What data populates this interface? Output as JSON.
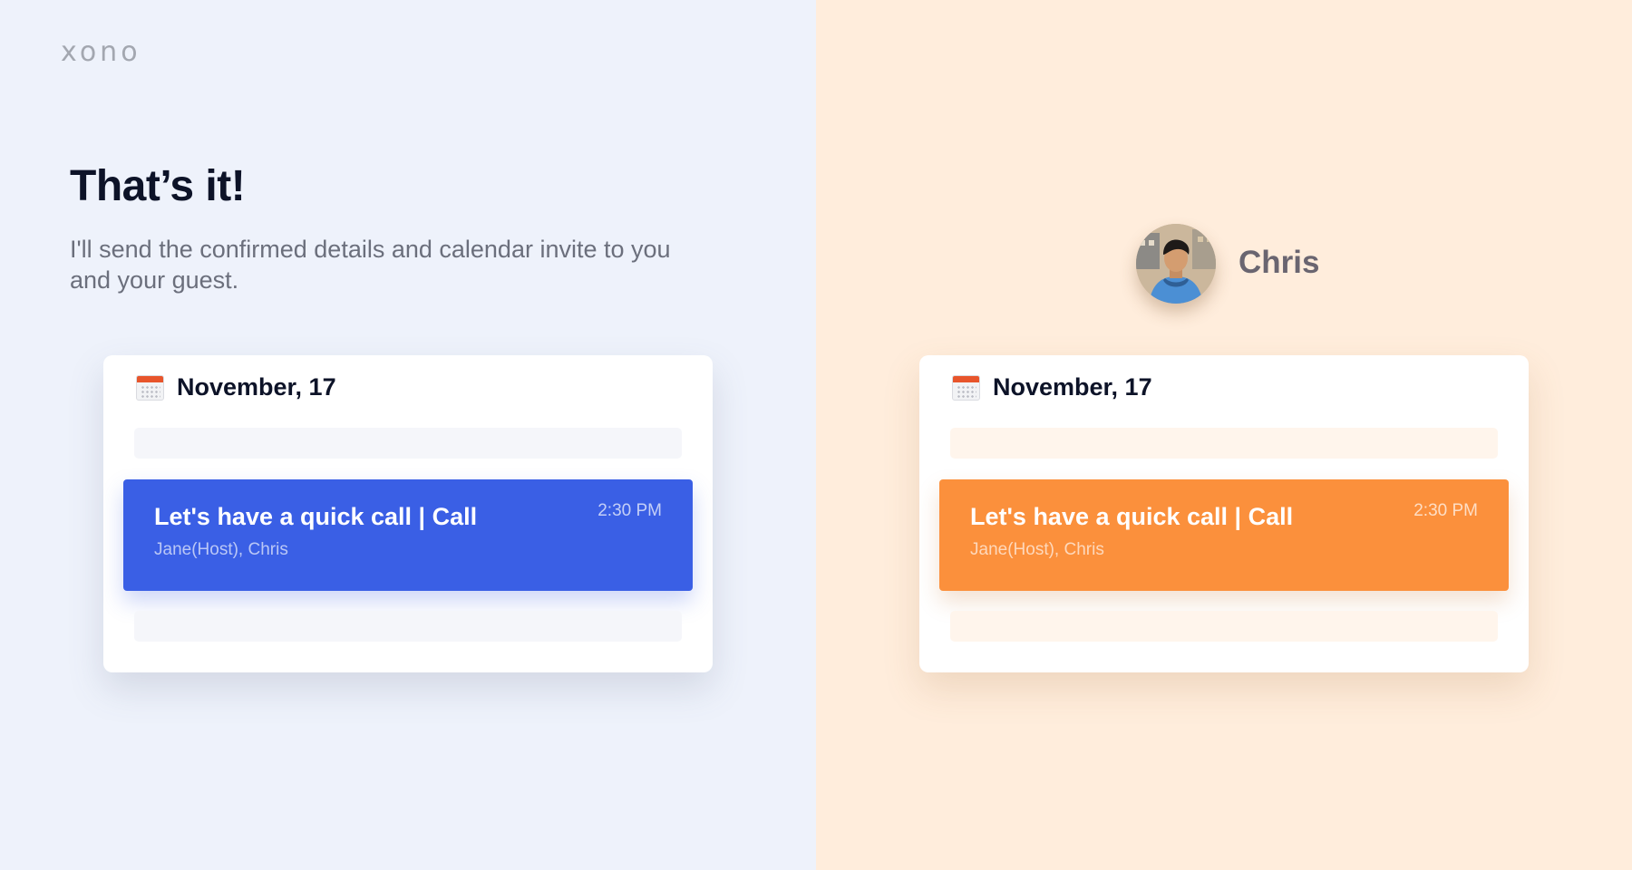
{
  "logo": "xono",
  "intro": {
    "headline": "That’s it!",
    "subtext": "I'll send the confirmed details and calendar invite to you and your guest."
  },
  "guest": {
    "name": "Chris"
  },
  "host_card": {
    "date": "November, 17",
    "event": {
      "title": "Let's have a quick call | Call",
      "guests": "Jane(Host), Chris",
      "time": "2:30 PM"
    }
  },
  "guest_card": {
    "date": "November, 17",
    "event": {
      "title": "Let's have a quick call | Call",
      "guests": "Jane(Host), Chris",
      "time": "2:30 PM"
    }
  },
  "colors": {
    "host_accent": "#3a5fe5",
    "guest_accent": "#fb903c",
    "left_bg": "#eef2fb",
    "right_bg": "#ffeddc"
  }
}
